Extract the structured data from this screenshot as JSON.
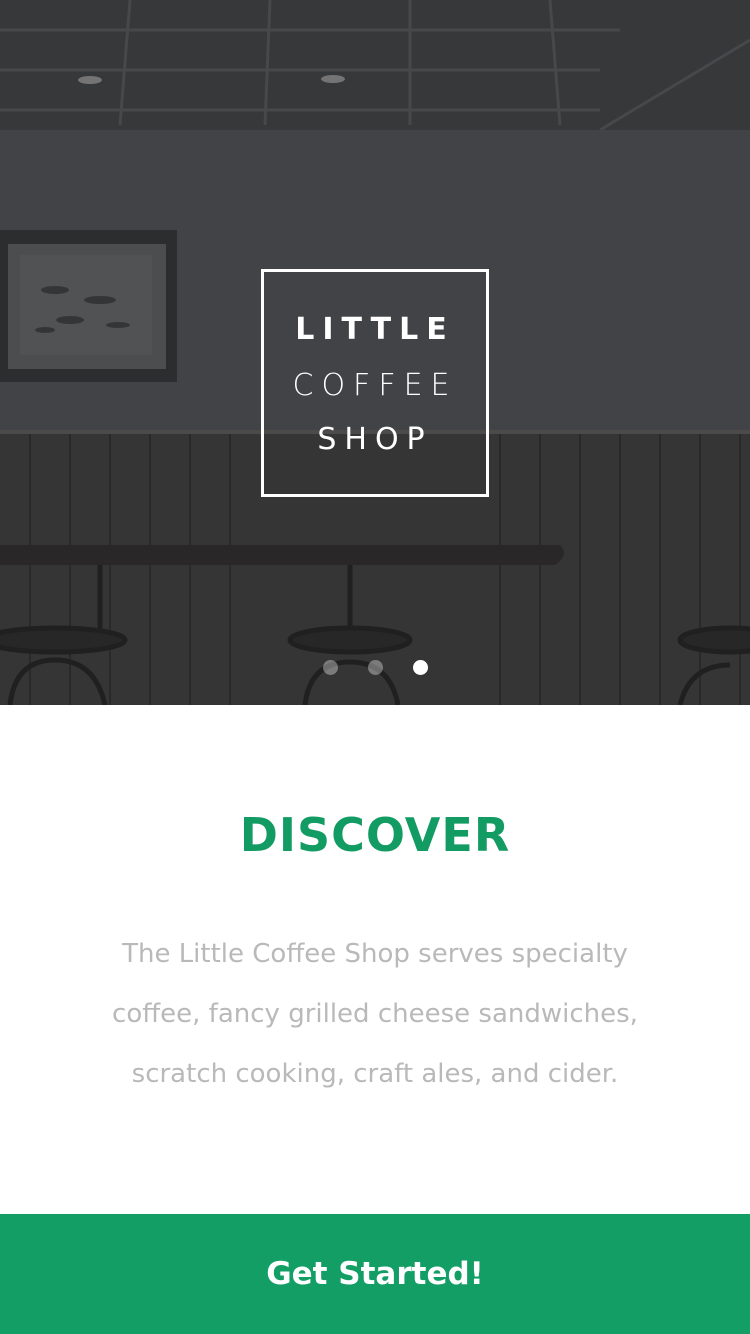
{
  "hero": {
    "logo": {
      "line1": "LITTLE",
      "line2": "COFFEE",
      "line3": "SHOP"
    },
    "carousel": {
      "total": 3,
      "active_index": 2
    }
  },
  "content": {
    "title": "DISCOVER",
    "description": "The Little Coffee Shop serves specialty coffee, fancy grilled cheese sandwiches, scratch cooking, craft ales, and cider."
  },
  "cta": {
    "label": "Get Started!"
  },
  "colors": {
    "accent": "#129e64",
    "title": "#129b62",
    "body_text": "#b9b9b9"
  }
}
